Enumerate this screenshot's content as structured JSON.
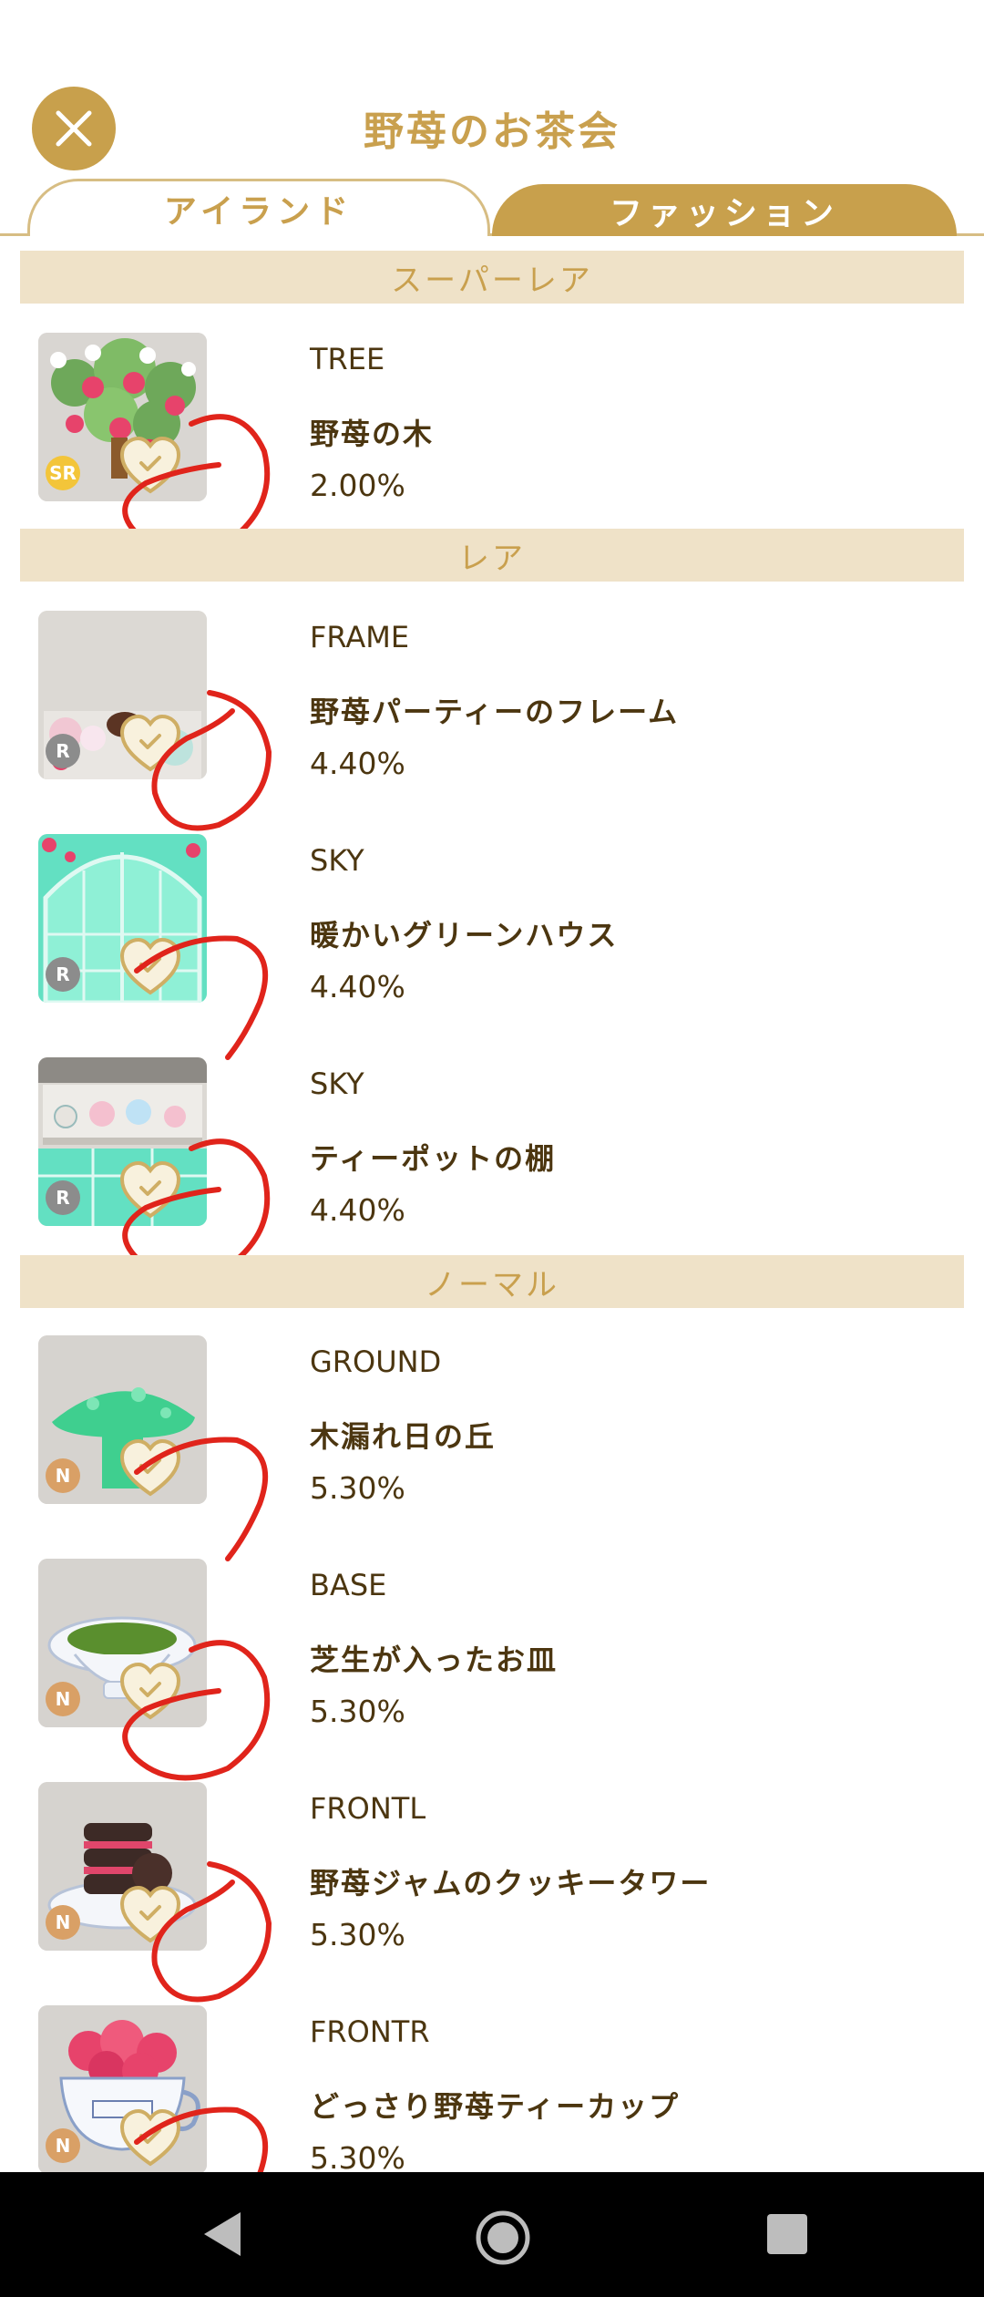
{
  "header": {
    "title": "野苺のお茶会",
    "close_icon": "close-icon"
  },
  "tabs": [
    {
      "label": "アイランド",
      "active": false
    },
    {
      "label": "ファッション",
      "active": true
    }
  ],
  "sections": [
    {
      "label": "スーパーレア",
      "items": [
        {
          "type": "TREE",
          "name": "野苺の木",
          "rate": "2.00%",
          "rarity": "SR",
          "rarity_color": "#f3c53a",
          "thumb": "strawberry-tree"
        }
      ]
    },
    {
      "label": "レア",
      "items": [
        {
          "type": "FRAME",
          "name": "野苺パーティーのフレーム",
          "rate": "4.40%",
          "rarity": "R",
          "rarity_color": "#8c8c8c",
          "thumb": "party-frame"
        },
        {
          "type": "SKY",
          "name": "暖かいグリーンハウス",
          "rate": "4.40%",
          "rarity": "R",
          "rarity_color": "#8c8c8c",
          "thumb": "greenhouse"
        },
        {
          "type": "SKY",
          "name": "ティーポットの棚",
          "rate": "4.40%",
          "rarity": "R",
          "rarity_color": "#8c8c8c",
          "thumb": "teapot-shelf"
        }
      ]
    },
    {
      "label": "ノーマル",
      "items": [
        {
          "type": "GROUND",
          "name": "木漏れ日の丘",
          "rate": "5.30%",
          "rarity": "N",
          "rarity_color": "#d9a066",
          "thumb": "green-hill"
        },
        {
          "type": "BASE",
          "name": "芝生が入ったお皿",
          "rate": "5.30%",
          "rarity": "N",
          "rarity_color": "#d9a066",
          "thumb": "grass-plate"
        },
        {
          "type": "FRONTL",
          "name": "野苺ジャムのクッキータワー",
          "rate": "5.30%",
          "rarity": "N",
          "rarity_color": "#d9a066",
          "thumb": "cookie-tower"
        },
        {
          "type": "FRONTR",
          "name": "どっさり野苺ティーカップ",
          "rate": "5.30%",
          "rarity": "N",
          "rarity_color": "#d9a066",
          "thumb": "strawberry-teacup"
        }
      ]
    }
  ],
  "colors": {
    "accent": "#c8a04c",
    "section_bg": "#efe2c8",
    "text": "#4c3610",
    "annotation": "#e0241b"
  },
  "nav": {
    "back_icon": "back-triangle-icon",
    "home_icon": "home-circle-icon",
    "recent_icon": "recent-square-icon"
  }
}
